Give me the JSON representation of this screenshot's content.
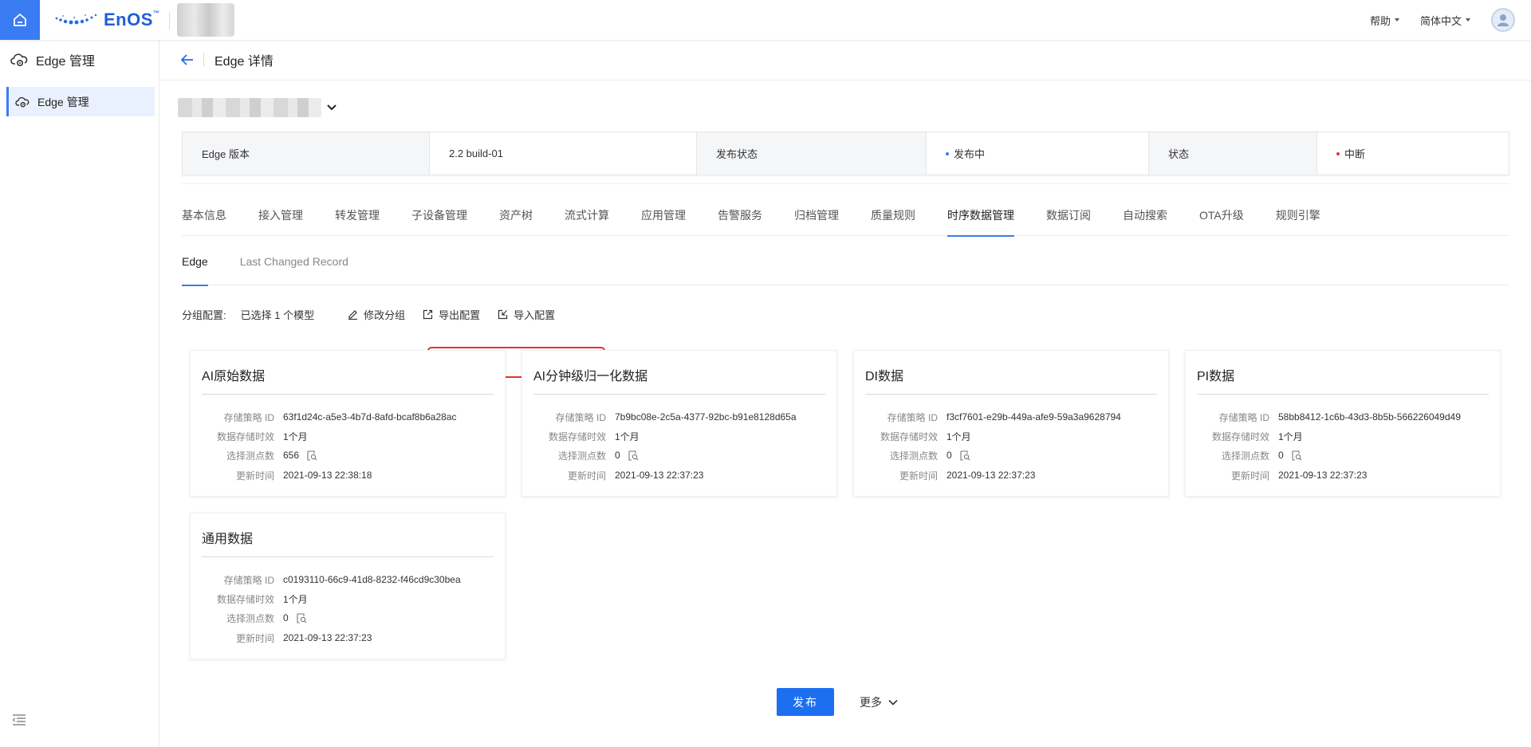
{
  "topbar": {
    "logo_text": "EnOS",
    "logo_tm": "™",
    "help": "帮助",
    "language": "简体中文"
  },
  "sidebar": {
    "header": "Edge 管理",
    "items": [
      {
        "label": "Edge 管理"
      }
    ]
  },
  "page": {
    "title": "Edge 详情"
  },
  "info": {
    "version_label": "Edge 版本",
    "version_value": "2.2 build-01",
    "publish_label": "发布状态",
    "publish_value": "发布中",
    "status_label": "状态",
    "status_value": "中断",
    "publish_dot_color": "#3a7cf1",
    "status_dot_color": "#e5322d"
  },
  "tabs": [
    "基本信息",
    "接入管理",
    "转发管理",
    "子设备管理",
    "资产树",
    "流式计算",
    "应用管理",
    "告警服务",
    "归档管理",
    "质量规则",
    "时序数据管理",
    "数据订阅",
    "自动搜索",
    "OTA升级",
    "规则引擎"
  ],
  "active_tab": "时序数据管理",
  "subtabs": [
    "Edge",
    "Last Changed Record"
  ],
  "group": {
    "label": "分组配置:",
    "value": "已选择 1 个模型",
    "edit": "修改分组",
    "export": "导出配置",
    "import": "导入配置"
  },
  "card_keys": {
    "policy": "存储策略 ID",
    "ttl": "数据存储时效",
    "points": "选择测点数",
    "updated": "更新时间"
  },
  "cards": [
    {
      "title": "AI原始数据",
      "policy": "63f1d24c-a5e3-4b7d-8afd-bcaf8b6a28ac",
      "ttl": "1个月",
      "points": "656",
      "updated": "2021-09-13 22:38:18"
    },
    {
      "title": "AI分钟级归一化数据",
      "policy": "7b9bc08e-2c5a-4377-92bc-b91e8128d65a",
      "ttl": "1个月",
      "points": "0",
      "updated": "2021-09-13 22:37:23"
    },
    {
      "title": "DI数据",
      "policy": "f3cf7601-e29b-449a-afe9-59a3a9628794",
      "ttl": "1个月",
      "points": "0",
      "updated": "2021-09-13 22:37:23"
    },
    {
      "title": "PI数据",
      "policy": "58bb8412-1c6b-43d3-8b5b-566226049d49",
      "ttl": "1个月",
      "points": "0",
      "updated": "2021-09-13 22:37:23"
    },
    {
      "title": "通用数据",
      "policy": "c0193110-66c9-41d8-8232-f46cd9c30bea",
      "ttl": "1个月",
      "points": "0",
      "updated": "2021-09-13 22:37:23"
    }
  ],
  "footer": {
    "publish": "发布",
    "more": "更多"
  },
  "colors": {
    "accent": "#3a7cf1",
    "highlight": "#e5322d"
  }
}
